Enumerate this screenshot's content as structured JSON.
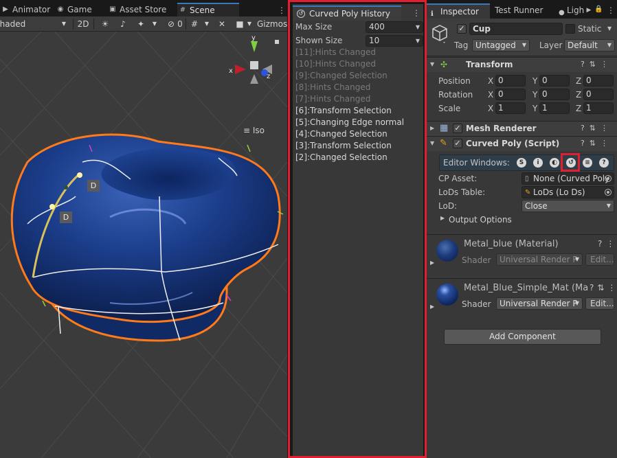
{
  "scene_panel": {
    "tabs": [
      {
        "label": "Animator",
        "icon": "animator-icon"
      },
      {
        "label": "Game",
        "icon": "gamepad-icon"
      },
      {
        "label": "Asset Store",
        "icon": "shopping-bag-icon"
      },
      {
        "label": "Scene",
        "icon": "scene-grid-icon"
      }
    ],
    "toolbar": {
      "draw_mode": "Shaded",
      "mode_2d": "2D",
      "hidden_count": "0",
      "gizmos": "Gizmos"
    },
    "view": {
      "projection_label": "Iso",
      "gizmo_axes": [
        "y",
        "x",
        "z"
      ],
      "handle_labels": [
        "D",
        "D"
      ]
    }
  },
  "history_panel": {
    "tab_label": "Curved Poly History",
    "fields": [
      {
        "label": "Max Size",
        "value": "400"
      },
      {
        "label": "Shown Size",
        "value": "10"
      }
    ],
    "entries": [
      {
        "text": "[11]:Hints Changed",
        "dim": true
      },
      {
        "text": "[10]:Hints Changed",
        "dim": true
      },
      {
        "text": "[9]:Changed Selection",
        "dim": true
      },
      {
        "text": "[8]:Hints Changed",
        "dim": true
      },
      {
        "text": "[7]:Hints Changed",
        "dim": true
      },
      {
        "text": "[6]:Transform Selection",
        "dim": false
      },
      {
        "text": "[5]:Changing Edge normal",
        "dim": false
      },
      {
        "text": "[4]:Changed Selection",
        "dim": false
      },
      {
        "text": "[3]:Transform Selection",
        "dim": false
      },
      {
        "text": "[2]:Changed Selection",
        "dim": false
      }
    ]
  },
  "inspector": {
    "tabs": [
      "Inspector",
      "Test Runner",
      "Ligh"
    ],
    "object_name": "Cup",
    "static_label": "Static",
    "tag_label": "Tag",
    "tag_value": "Untagged",
    "layer_label": "Layer",
    "layer_value": "Default",
    "transform": {
      "title": "Transform",
      "rows": [
        {
          "label": "Position",
          "x": "0",
          "y": "0",
          "z": "0"
        },
        {
          "label": "Rotation",
          "x": "0",
          "y": "0",
          "z": "0"
        },
        {
          "label": "Scale",
          "x": "1",
          "y": "1",
          "z": "1"
        }
      ]
    },
    "mesh_renderer": {
      "title": "Mesh Renderer"
    },
    "curved_poly": {
      "title": "Curved Poly (Script)",
      "editor_windows_label": "Editor Windows:",
      "cp_asset_label": "CP Asset:",
      "cp_asset_value": "None (Curved Poly",
      "lods_table_label": "LoDs Table:",
      "lods_table_value": "LoDs (Lo Ds)",
      "lod_label": "LoD:",
      "lod_value": "Close",
      "output_options_label": "Output Options"
    },
    "materials": [
      {
        "name": "Metal_blue (Material)",
        "shader_label": "Shader",
        "shader_value": "Universal Render P",
        "edit_label": "Edit..."
      },
      {
        "name": "Metal_Blue_Simple_Mat (Ma",
        "shader_label": "Shader",
        "shader_value": "Universal Render P",
        "edit_label": "Edit..."
      }
    ],
    "add_component_label": "Add Component"
  },
  "colors": {
    "accent_tab": "#3a79bb",
    "highlight_red": "#e02030",
    "selection_orange": "#ff7a1a",
    "mesh_blue": "#1b3d8a"
  }
}
